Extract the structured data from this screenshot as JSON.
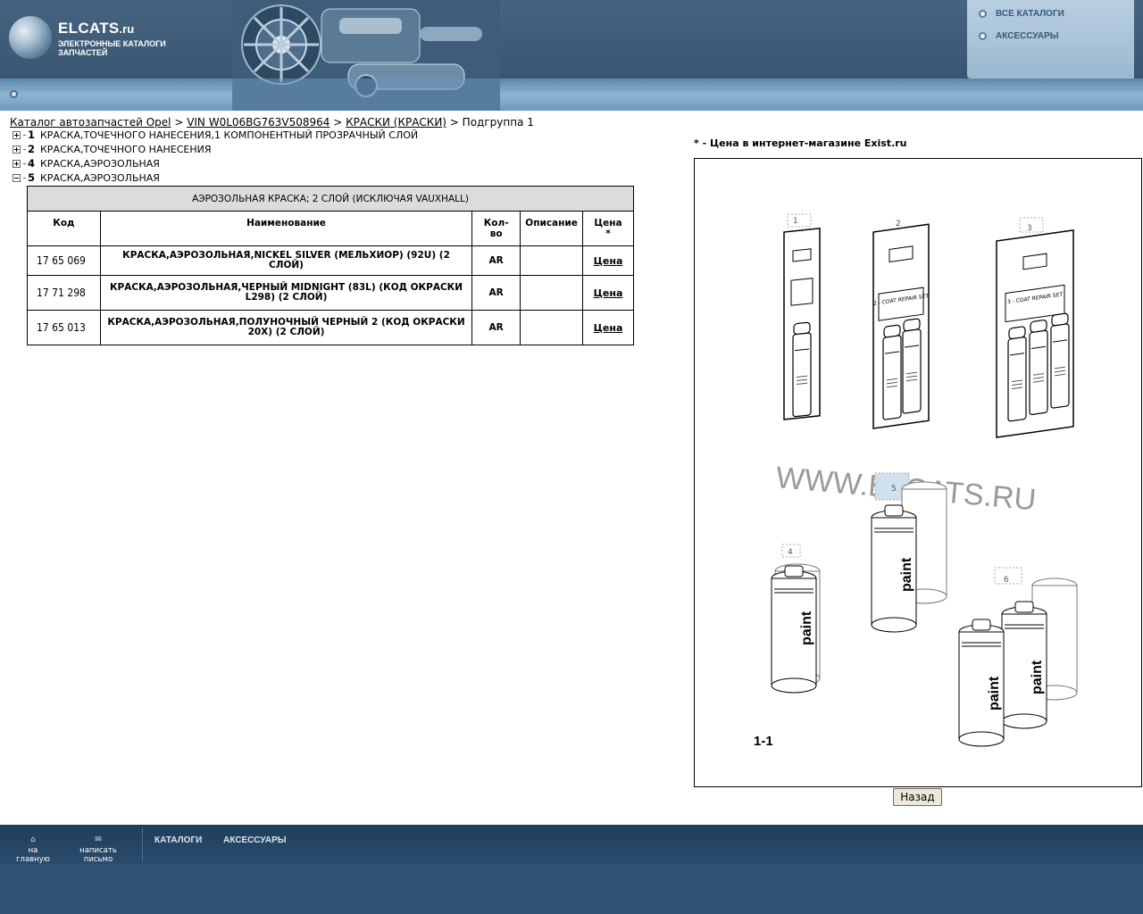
{
  "header": {
    "brand_name": "ELCATS",
    "brand_tld": ".ru",
    "tagline": "ЭЛЕКТРОННЫЕ КАТАЛОГИ ЗАПЧАСТЕЙ",
    "menu": [
      {
        "label": "ВСЕ КАТАЛОГИ"
      },
      {
        "label": "АКСЕССУАРЫ"
      }
    ]
  },
  "breadcrumb": {
    "link1": "Каталог автозапчастей Opel",
    "sep1": " > ",
    "link2": "VIN W0L06BG763V508964",
    "sep2": " > ",
    "link3": "КРАСКИ (КРАСКИ)",
    "sep3": " > ",
    "current": "Подгруппа 1"
  },
  "tree": [
    {
      "num": "1",
      "label": "КРАСКА,ТОЧЕЧНОГО НАНЕСЕНИЯ,1 КОМПОНЕНТНЫЙ ПРОЗРАЧНЫЙ СЛОЙ",
      "expanded": false
    },
    {
      "num": "2",
      "label": "КРАСКА,ТОЧЕЧНОГО НАНЕСЕНИЯ",
      "expanded": false
    },
    {
      "num": "4",
      "label": "КРАСКА,АЭРОЗОЛЬНАЯ",
      "expanded": false
    },
    {
      "num": "5",
      "label": "КРАСКА,АЭРОЗОЛЬНАЯ",
      "expanded": true
    }
  ],
  "table": {
    "caption": "АЭРОЗОЛЬНАЯ КРАСКА; 2 СЛОЙ (ИСКЛЮЧАЯ VAUXHALL)",
    "headers": {
      "code": "Код",
      "name": "Наименование",
      "qty_line1": "Кол-",
      "qty_line2": "во",
      "desc": "Описание",
      "price_line1": "Цена",
      "price_line2": "*"
    },
    "rows": [
      {
        "code": "17 65 069",
        "name": "КРАСКА,АЭРОЗОЛЬНАЯ,NICKEL SILVER (МЕЛЬХИОР) (92U) (2 СЛОЙ)",
        "qty": "AR",
        "desc": "",
        "price": "Цена"
      },
      {
        "code": "17 71 298",
        "name": "КРАСКА,АЭРОЗОЛЬНАЯ,ЧЕРНЫЙ MIDNIGHT (83L) (КОД ОКРАСКИ L298) (2 СЛОЙ)",
        "qty": "AR",
        "desc": "",
        "price": "Цена"
      },
      {
        "code": "17 65 013",
        "name": "КРАСКА,АЭРОЗОЛЬНАЯ,ПОЛУНОЧНЫЙ ЧЕРНЫЙ 2 (КОД ОКРАСКИ 20X) (2 СЛОЙ)",
        "qty": "AR",
        "desc": "",
        "price": "Цена"
      }
    ]
  },
  "price_note": "* - Цена в интернет-магазине Exist.ru",
  "diagram": {
    "callouts": [
      "1",
      "2",
      "3",
      "4",
      "5",
      "6"
    ],
    "card_text_2": "2 - COAT REPAIR SET",
    "card_text_3": "3 - COAT REPAIR SET",
    "can_label": "paint",
    "watermark": "WWW.ELCATS.RU",
    "figure_id": "1-1"
  },
  "back_button": "Назад",
  "footer": {
    "home": "на главную",
    "write": "написать письмо",
    "nav": [
      "КАТАЛОГИ",
      "АКСЕССУАРЫ"
    ]
  }
}
